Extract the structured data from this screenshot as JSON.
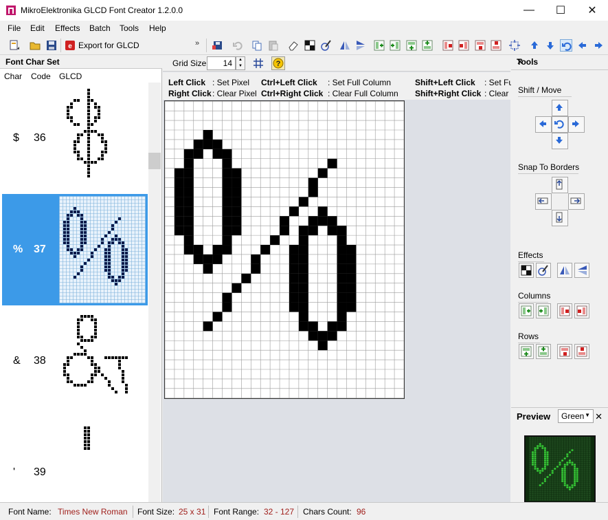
{
  "window": {
    "title": "MikroElektronika GLCD Font Creator 1.2.0.0",
    "minimize_glyph": "—",
    "maximize_glyph": "☐",
    "close_glyph": "✕"
  },
  "menu": [
    "File",
    "Edit",
    "Effects",
    "Batch",
    "Tools",
    "Help"
  ],
  "toolbar": {
    "export_label": "Export for GLCD",
    "overflow_glyph": "»"
  },
  "font_char_set": {
    "title": "Font Char Set",
    "columns": [
      "Char",
      "Code",
      "GLCD"
    ],
    "rows": [
      {
        "char": "$",
        "code": "36",
        "selected": false
      },
      {
        "char": "%",
        "code": "37",
        "selected": true
      },
      {
        "char": "&",
        "code": "38",
        "selected": false
      },
      {
        "char": "'",
        "code": "39",
        "selected": false
      }
    ]
  },
  "editor": {
    "grid_size_label": "Grid Size",
    "grid_size_value": "14",
    "help_glyph": "?",
    "hints": [
      {
        "key": "Left Click",
        "action": ": Set Pixel"
      },
      {
        "key": "Right Click",
        "action": ": Clear Pixel"
      },
      {
        "key": "Ctrl+Left Click",
        "action": ": Set Full Column"
      },
      {
        "key": "Ctrl+Right Click",
        "action": ": Clear Full Column"
      },
      {
        "key": "Shift+Left Click",
        "action": ": Set Fu"
      },
      {
        "key": "Shift+Right Click",
        "action": ": Clear I"
      }
    ]
  },
  "tools": {
    "title": "Tools",
    "shift_move": "Shift / Move",
    "snap_to_borders": "Snap To Borders",
    "effects": "Effects",
    "columns": "Columns",
    "rows": "Rows"
  },
  "preview": {
    "title": "Preview",
    "color": "Green",
    "fg": "#3bd23b",
    "bg": "#0d2b0d"
  },
  "status": {
    "font_name_label": "Font Name:",
    "font_name": "Times New Roman",
    "font_size_label": "Font Size:",
    "font_size": "25 x 31",
    "font_range_label": "Font Range:",
    "font_range": "32 - 127",
    "chars_count_label": "Chars Count:",
    "chars_count": "96"
  },
  "colors": {
    "selection": "#3c9ae8",
    "status_value": "#a0201c",
    "pixel_on": "#000000"
  }
}
